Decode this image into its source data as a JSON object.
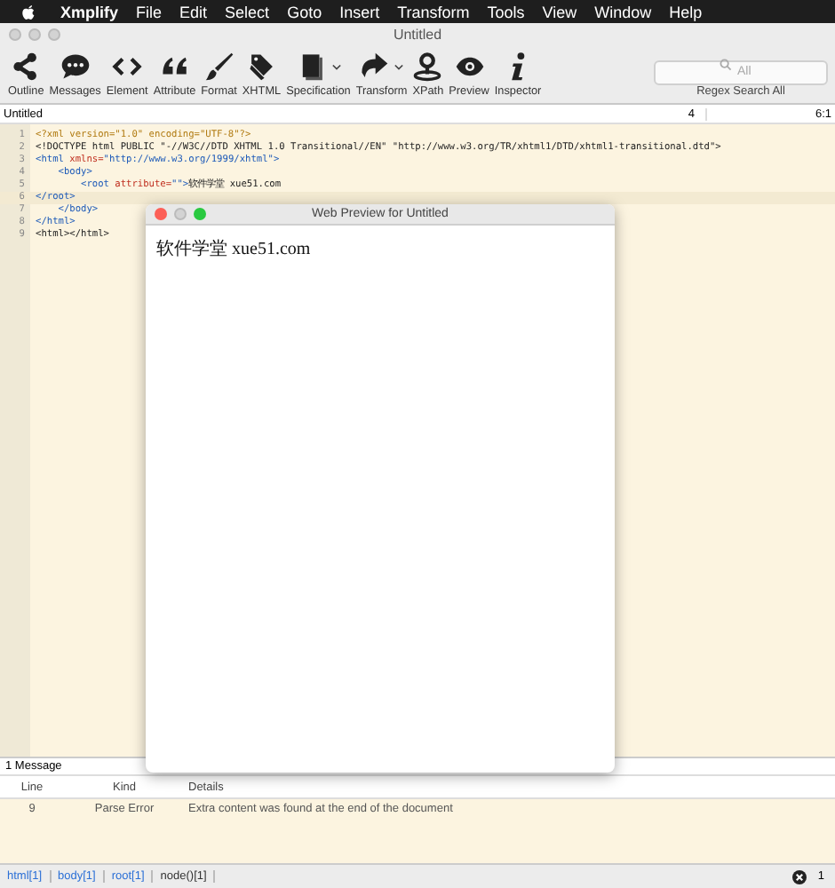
{
  "menu_bar": {
    "app": "Xmplify",
    "items": [
      "File",
      "Edit",
      "Select",
      "Goto",
      "Insert",
      "Transform",
      "Tools",
      "View",
      "Window",
      "Help"
    ]
  },
  "window": {
    "title": "Untitled"
  },
  "toolbar": [
    {
      "label": "Outline",
      "kind": "outline",
      "dropdown": false
    },
    {
      "label": "Messages",
      "kind": "messages",
      "dropdown": false
    },
    {
      "label": "Element",
      "kind": "element",
      "dropdown": false
    },
    {
      "label": "Attribute",
      "kind": "attribute",
      "dropdown": false
    },
    {
      "label": "Format",
      "kind": "format",
      "dropdown": false
    },
    {
      "label": "XHTML",
      "kind": "xhtml",
      "dropdown": false
    },
    {
      "label": "Specification",
      "kind": "specification",
      "dropdown": true
    },
    {
      "label": "Transform",
      "kind": "transform",
      "dropdown": true
    },
    {
      "label": "XPath",
      "kind": "xpath",
      "dropdown": false
    },
    {
      "label": "Preview",
      "kind": "preview",
      "dropdown": false
    },
    {
      "label": "Inspector",
      "kind": "inspector",
      "dropdown": false
    }
  ],
  "search": {
    "placeholder": "All",
    "label": "Regex Search All"
  },
  "editor_bar": {
    "file": "Untitled",
    "column_2": "4",
    "column_3": "6:1"
  },
  "editor_lines": [
    {
      "num": "1",
      "selected": false,
      "tokens": [
        {
          "kind": "pi",
          "text": "<?xml version=\"1.0\" encoding=\"UTF-8\"?>"
        }
      ]
    },
    {
      "num": "2",
      "selected": false,
      "tokens": [
        {
          "kind": "plain",
          "text": "<!DOCTYPE html PUBLIC \"-//W3C//DTD XHTML 1.0 Transitional//EN\" \"http://www.w3.org/TR/xhtml1/DTD/xhtml1-transitional.dtd\">"
        }
      ]
    },
    {
      "num": "3",
      "selected": false,
      "tokens": [
        {
          "kind": "tag",
          "text": "<html "
        },
        {
          "kind": "attr",
          "text": "xmlns="
        },
        {
          "kind": "tag",
          "text": "\"http://www.w3.org/1999/xhtml\">"
        }
      ]
    },
    {
      "num": "4",
      "selected": false,
      "tokens": [
        {
          "kind": "tag",
          "text": "    <body>"
        }
      ]
    },
    {
      "num": "5",
      "selected": false,
      "tokens": [
        {
          "kind": "tag",
          "text": "        <root "
        },
        {
          "kind": "attr",
          "text": "attribute="
        },
        {
          "kind": "tag",
          "text": "\"\">"
        },
        {
          "kind": "plain",
          "text": "软件学堂 xue51.com"
        }
      ]
    },
    {
      "num": "6",
      "selected": true,
      "tokens": [
        {
          "kind": "tag",
          "text": "</root>"
        }
      ]
    },
    {
      "num": "7",
      "selected": false,
      "tokens": [
        {
          "kind": "tag",
          "text": "    </body>"
        }
      ]
    },
    {
      "num": "8",
      "selected": false,
      "tokens": [
        {
          "kind": "tag",
          "text": "</html>"
        }
      ]
    },
    {
      "num": "9",
      "selected": false,
      "tokens": [
        {
          "kind": "plain",
          "text": "<html></html>"
        }
      ]
    }
  ],
  "preview_window": {
    "title": "Web Preview for Untitled",
    "content": "软件学堂 xue51.com"
  },
  "messages": {
    "title": "1 Message",
    "columns": [
      "Line",
      "Kind",
      "Details"
    ],
    "rows": [
      {
        "line": "9",
        "kind": "Parse Error",
        "details": "Extra content was found at the end of the document"
      }
    ]
  },
  "breadcrumbs": [
    {
      "label": "html[1]",
      "kind": "link"
    },
    {
      "label": "body[1]",
      "kind": "link"
    },
    {
      "label": "root[1]",
      "kind": "link"
    },
    {
      "label": "node()[1]",
      "kind": "current"
    }
  ],
  "error_count": "1"
}
